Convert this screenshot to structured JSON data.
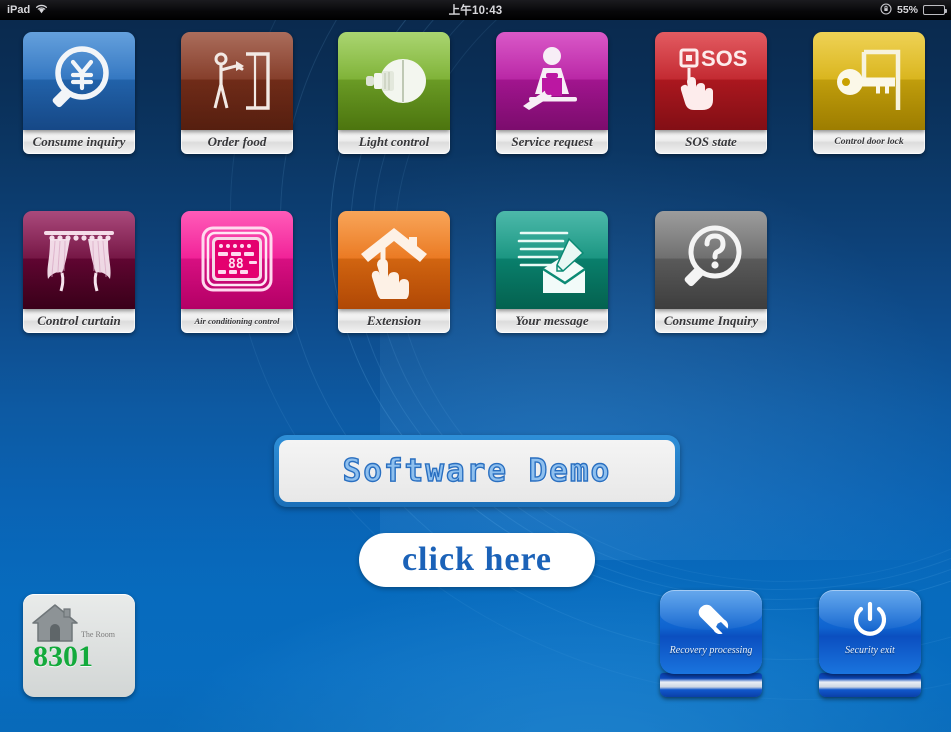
{
  "status_bar": {
    "carrier": "iPad",
    "wifi_icon": "wifi-icon",
    "time": "上午10:43",
    "rotation_lock_icon": "rotation-lock-icon",
    "battery_percent": "55%",
    "battery_icon": "battery-icon",
    "battery_level": 55
  },
  "colors": {
    "wallpaper_top": "#0a2a4e",
    "wallpaper_bottom": "#0566bb",
    "room_number_green": "#13aa3c",
    "click_here_blue": "#1b62b8",
    "demo_text_blue": "#8fc0ee"
  },
  "apps": [
    {
      "id": "consume-inquiry",
      "label": "Consume inquiry",
      "icon": "magnifier-yen-icon",
      "color_start": "#2f7fd0",
      "color_end": "#1b5aa8",
      "label_size": "normal"
    },
    {
      "id": "order-food",
      "label": "Order food",
      "icon": "waiter-door-icon",
      "color_start": "#8d3a23",
      "color_end": "#6b2613",
      "label_size": "normal"
    },
    {
      "id": "light-control",
      "label": "Light control",
      "icon": "lightbulb-icon",
      "color_start": "#8cc63f",
      "color_end": "#5f9212",
      "label_size": "normal"
    },
    {
      "id": "service-request",
      "label": "Service request",
      "icon": "concierge-bell-icon",
      "color_start": "#cc1fb4",
      "color_end": "#9a0f88",
      "label_size": "normal"
    },
    {
      "id": "sos-state",
      "label": "SOS  state",
      "icon": "sos-hand-icon",
      "color_start": "#d8222a",
      "color_end": "#a3121a",
      "label_size": "normal"
    },
    {
      "id": "control-door-lock",
      "label": "Control door lock",
      "icon": "key-door-icon",
      "color_start": "#e8c21a",
      "color_end": "#c49c00",
      "label_size": "small"
    },
    {
      "id": "control-curtain",
      "label": "Control curtain",
      "icon": "curtain-icon",
      "color_start": "#8c0b4e",
      "color_end": "#48001f",
      "label_size": "normal"
    },
    {
      "id": "air-conditioning",
      "label": "Air conditioning control",
      "icon": "ac-remote-icon",
      "color_start": "#ff22a0",
      "color_end": "#e0007f",
      "label_size": "tiny"
    },
    {
      "id": "extension",
      "label": "Extension",
      "icon": "house-hand-icon",
      "color_start": "#f5851f",
      "color_end": "#dc5a06",
      "label_size": "normal"
    },
    {
      "id": "your-message",
      "label": "Your message",
      "icon": "envelope-pen-icon",
      "color_start": "#0fa08c",
      "color_end": "#057a63",
      "label_size": "normal"
    },
    {
      "id": "consume-inquiry-2",
      "label": "Consume Inquiry",
      "icon": "magnifier-question-icon",
      "color_start": "#7a7a7a",
      "color_end": "#4d4d4d",
      "label_size": "normal"
    }
  ],
  "demo_panel": {
    "label": "Software Demo"
  },
  "click_here": {
    "label": "click here"
  },
  "room_plate": {
    "home_icon": "home-icon",
    "caption": "The Room",
    "number": "8301"
  },
  "dock_buttons": [
    {
      "id": "recovery-processing",
      "label": "Recovery processing",
      "icon": "wrench-icon"
    },
    {
      "id": "security-exit",
      "label": "Security exit",
      "icon": "power-icon"
    }
  ]
}
